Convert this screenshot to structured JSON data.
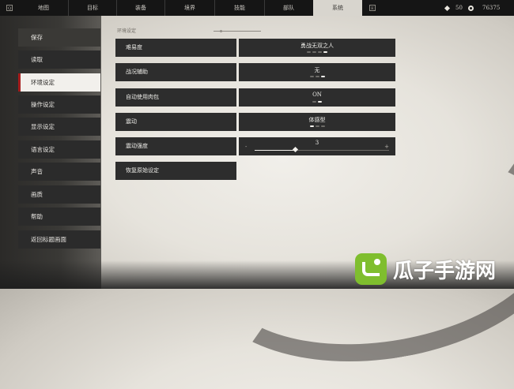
{
  "topbar": {
    "key_left": "Q",
    "key_right": "E",
    "tabs": [
      {
        "label": "地图",
        "active": false
      },
      {
        "label": "目标",
        "active": false
      },
      {
        "label": "装备",
        "active": false
      },
      {
        "label": "境界",
        "active": false
      },
      {
        "label": "技能",
        "active": false
      },
      {
        "label": "部队",
        "active": false
      },
      {
        "label": "系统",
        "active": true
      }
    ],
    "currency_1": "50",
    "currency_2": "76375"
  },
  "sidebar": {
    "items": [
      {
        "label": "保存"
      },
      {
        "label": "读取"
      },
      {
        "label": "环境设定",
        "active": true
      },
      {
        "label": "操作设定"
      },
      {
        "label": "显示设定"
      },
      {
        "label": "语言设定"
      },
      {
        "label": "声音"
      },
      {
        "label": "画质"
      },
      {
        "label": "帮助"
      },
      {
        "label": "返回标题画面"
      }
    ]
  },
  "main": {
    "section_title": "环境设定",
    "settings": [
      {
        "label": "难易度",
        "value": "勇战无双之人",
        "dots": 4,
        "selected": 3
      },
      {
        "label": "战况辅助",
        "value": "无",
        "dots": 3,
        "selected": 2
      },
      {
        "label": "自动使用肉包",
        "value": "ON",
        "dots": 2,
        "selected": 1
      },
      {
        "label": "震动",
        "value": "体感型",
        "dots": 3,
        "selected": 0
      },
      {
        "label": "震动强度",
        "value": "3",
        "minus": "-",
        "plus": "+",
        "level": 0.3
      },
      {
        "label": "恢复原始设定"
      }
    ]
  },
  "watermark": {
    "text": "瓜子手游网"
  },
  "colors": {
    "accent_red": "#a61c1c",
    "panel": "#2d2d2d",
    "watermark_green": "#7fbe2e"
  }
}
